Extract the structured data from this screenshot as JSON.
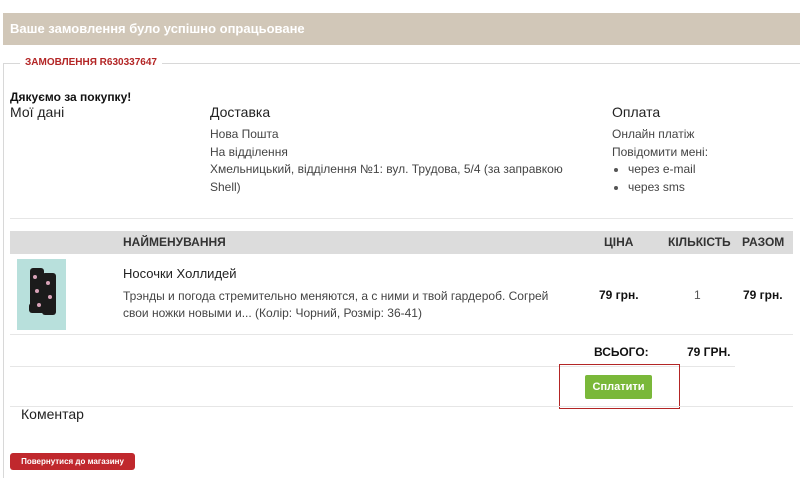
{
  "banner": {
    "text": "Ваше замовлення було успішно опрацьоване"
  },
  "order": {
    "legend": "ЗАМОВЛЕННЯ R630337647"
  },
  "thanks": "Дякуємо за покупку!",
  "my_data": {
    "title": "Мої дані"
  },
  "delivery": {
    "title": "Доставка",
    "carrier": "Нова Пошта",
    "method": "На відділення",
    "address_line1": "Хмельницький, відділення №1: вул. Трудова, 5/4 (за заправкою",
    "address_line2": "Shell)"
  },
  "payment": {
    "title": "Оплата",
    "method": "Онлайн платіж",
    "notify_label": "Повідомити мені:",
    "notify_options": [
      "через e-mail",
      "через sms"
    ]
  },
  "table": {
    "headers": {
      "name": "НАЙМЕНУВАННЯ",
      "price": "ЦІНА",
      "qty": "КІЛЬКІСТЬ",
      "total": "РАЗОМ"
    },
    "items": [
      {
        "name": "Носочки Холлидей",
        "description_line1": "Трэнды и погода стремительно меняются, а с ними и твой гардероб. Согрей",
        "description_line2": "свои ножки новыми и... (Колір: Чорний, Розмір: 36-41)",
        "price": "79 грн.",
        "qty": "1",
        "total": "79 грн."
      }
    ],
    "summary": {
      "label": "ВСЬОГО:",
      "value": "79 ГРН."
    }
  },
  "actions": {
    "pay_label": "Сплатити",
    "back_label": "Повернутися до магазину"
  },
  "comment": {
    "title": "Коментар"
  },
  "colors": {
    "banner_bg": "#d1c7b8",
    "accent_red": "#b32525",
    "pay_green": "#7ab83a",
    "back_red": "#c0282d"
  }
}
